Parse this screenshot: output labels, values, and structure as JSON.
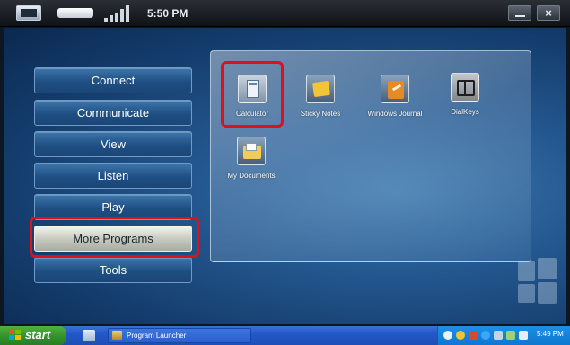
{
  "topbar": {
    "time": "5:50 PM",
    "icons": [
      "screen-icon",
      "battery-icon",
      "signal-icon"
    ],
    "close_glyph": "×"
  },
  "menu": {
    "items": [
      {
        "label": "Connect"
      },
      {
        "label": "Communicate"
      },
      {
        "label": "View"
      },
      {
        "label": "Listen"
      },
      {
        "label": "Play"
      },
      {
        "label": "More Programs",
        "active": true
      },
      {
        "label": "Tools"
      }
    ]
  },
  "programs": [
    {
      "label": "Calculator",
      "icon": "calculator-icon",
      "highlighted": true
    },
    {
      "label": "Sticky Notes",
      "icon": "sticky-notes-icon"
    },
    {
      "label": "Windows Journal",
      "icon": "windows-journal-icon"
    },
    {
      "label": "DialKeys",
      "icon": "dialkeys-icon"
    },
    {
      "label": "My Documents",
      "icon": "my-documents-icon"
    }
  ],
  "taskbar": {
    "start_label": "start",
    "task_label": "Program Launcher",
    "clock": "5:49 PM"
  },
  "colors": {
    "highlight": "#e0101a",
    "taskbar": "#2457c8",
    "start": "#2f8f2a"
  }
}
